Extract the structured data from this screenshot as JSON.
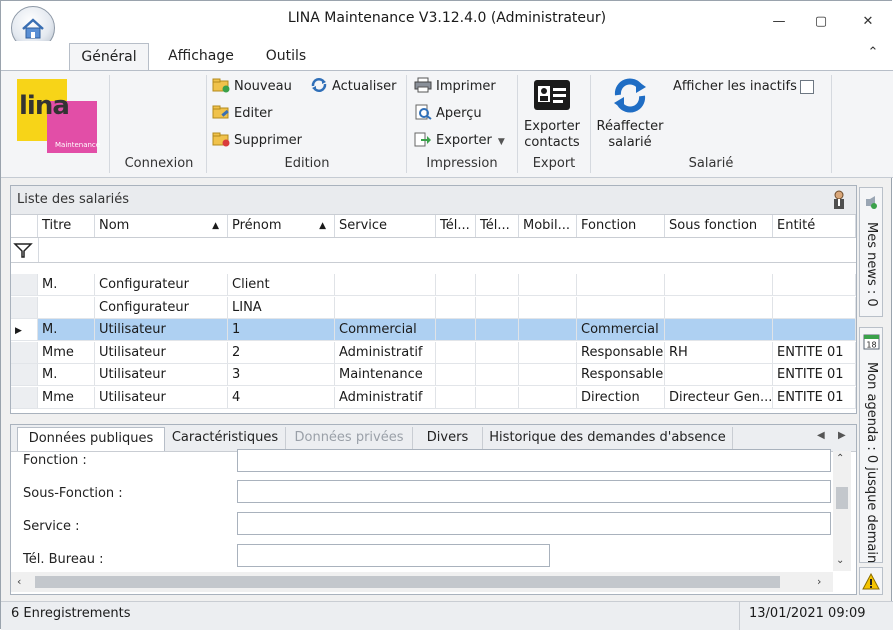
{
  "window": {
    "title": "LINA Maintenance  V3.12.4.0  (Administrateur)",
    "controls": {
      "minimize": "—",
      "maximize": "▢",
      "close": "✕",
      "collapse_ribbon": "⌃"
    }
  },
  "ribbon": {
    "tabs": [
      "Général",
      "Affichage",
      "Outils"
    ],
    "active_tab": "Général",
    "logo": {
      "text": "lina",
      "subtext": "Maintenance"
    },
    "groups": {
      "connexion": {
        "label": "Connexion"
      },
      "edition": {
        "label": "Edition",
        "nouveau": "Nouveau",
        "editer": "Editer",
        "supprimer": "Supprimer",
        "actualiser": "Actualiser"
      },
      "impression": {
        "label": "Impression",
        "imprimer": "Imprimer",
        "apercu": "Aperçu",
        "exporter": "Exporter"
      },
      "export": {
        "label": "Export",
        "exporter_contacts_line1": "Exporter",
        "exporter_contacts_line2": "contacts"
      },
      "salarie": {
        "label": "Salarié",
        "reaffecter_line1": "Réaffecter",
        "reaffecter_line2": "salarié",
        "afficher_inactifs": "Afficher les inactifs"
      }
    }
  },
  "list": {
    "title": "Liste des salariés",
    "columns": [
      "Titre",
      "Nom",
      "Prénom",
      "Service",
      "Tél...",
      "Tél...",
      "Mobil...",
      "Fonction",
      "Sous fonction",
      "Entité"
    ],
    "rows": [
      {
        "titre": "M.",
        "nom": "Configurateur",
        "prenom": "Client",
        "service": "",
        "tel1": "",
        "tel2": "",
        "mobile": "",
        "fonction": "",
        "sous_fonction": "",
        "entite": ""
      },
      {
        "titre": "",
        "nom": "Configurateur",
        "prenom": "LINA",
        "service": "",
        "tel1": "",
        "tel2": "",
        "mobile": "",
        "fonction": "",
        "sous_fonction": "",
        "entite": ""
      },
      {
        "titre": "M.",
        "nom": "Utilisateur",
        "prenom": "1",
        "service": "Commercial",
        "tel1": "",
        "tel2": "",
        "mobile": "",
        "fonction": "Commercial",
        "sous_fonction": "",
        "entite": ""
      },
      {
        "titre": "Mme",
        "nom": "Utilisateur",
        "prenom": "2",
        "service": "Administratif",
        "tel1": "",
        "tel2": "",
        "mobile": "",
        "fonction": "Responsable",
        "sous_fonction": "RH",
        "entite": "ENTITE 01"
      },
      {
        "titre": "M.",
        "nom": "Utilisateur",
        "prenom": "3",
        "service": "Maintenance",
        "tel1": "",
        "tel2": "",
        "mobile": "",
        "fonction": "Responsable",
        "sous_fonction": "",
        "entite": "ENTITE 01"
      },
      {
        "titre": "Mme",
        "nom": "Utilisateur",
        "prenom": "4",
        "service": "Administratif",
        "tel1": "",
        "tel2": "",
        "mobile": "",
        "fonction": "Direction",
        "sous_fonction": "Directeur Gen...",
        "entite": "ENTITE 01"
      }
    ],
    "selected_row": 2
  },
  "side_panels": {
    "news": "Mes news : 0",
    "agenda": "Mon agenda : 0 jusque demain",
    "agenda_day": "18"
  },
  "details": {
    "tabs": [
      "Données publiques",
      "Caractéristiques",
      "Données privées",
      "Divers",
      "Historique des demandes d'absence"
    ],
    "active_tab": "Données publiques",
    "disabled_tab": "Données privées",
    "fields": [
      {
        "label": "Fonction :",
        "value": ""
      },
      {
        "label": "Sous-Fonction :",
        "value": ""
      },
      {
        "label": "Service :",
        "value": ""
      },
      {
        "label": "Tél. Bureau :",
        "value": ""
      }
    ]
  },
  "status": {
    "records": "6 Enregistrements",
    "datetime": "13/01/2021 09:09"
  }
}
